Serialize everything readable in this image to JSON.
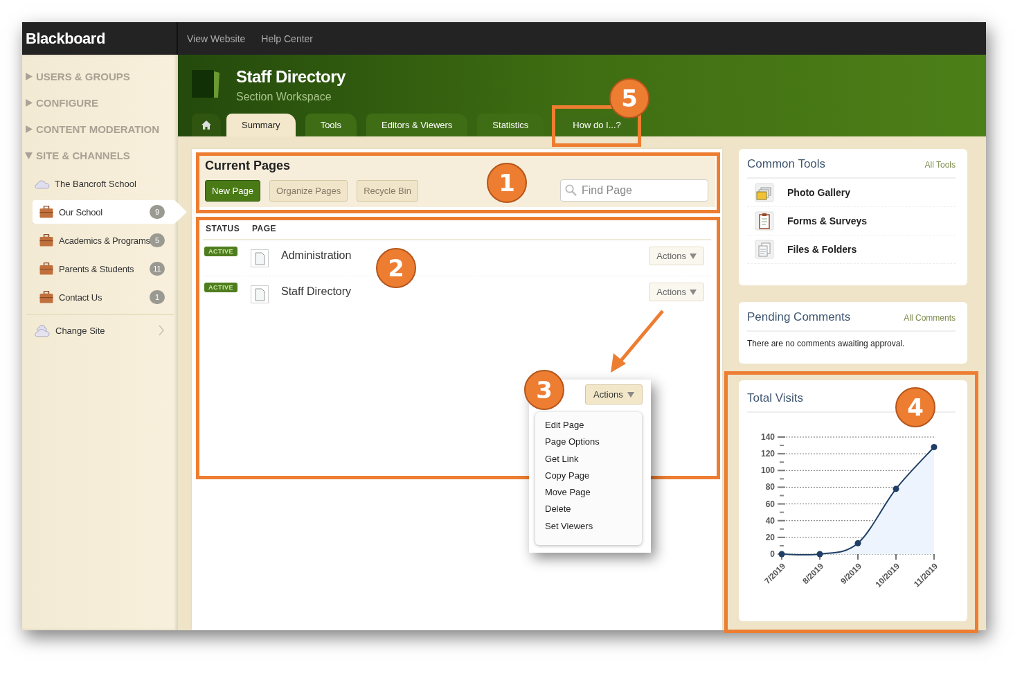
{
  "top_bar": {
    "logo": "Blackboard",
    "links": [
      "View Website",
      "Help Center"
    ]
  },
  "sidebar": {
    "sections": [
      {
        "label": "USERS & GROUPS",
        "expanded": false
      },
      {
        "label": "CONFIGURE",
        "expanded": false
      },
      {
        "label": "CONTENT MODERATION",
        "expanded": false
      },
      {
        "label": "SITE & CHANNELS",
        "expanded": true,
        "site": "The Bancroft School",
        "channels": [
          {
            "label": "Our School",
            "count": "9",
            "selected": true
          },
          {
            "label": "Academics & Programs",
            "count": "5",
            "selected": false
          },
          {
            "label": "Parents & Students",
            "count": "11",
            "selected": false
          },
          {
            "label": "Contact Us",
            "count": "1",
            "selected": false
          }
        ]
      }
    ],
    "change_site": "Change Site"
  },
  "header": {
    "title": "Staff Directory",
    "subtitle": "Section Workspace",
    "tabs": [
      {
        "kind": "home",
        "selected": false
      },
      {
        "kind": "text",
        "label": "Summary",
        "selected": true
      },
      {
        "kind": "text",
        "label": "Tools",
        "selected": false
      },
      {
        "kind": "text",
        "label": "Editors & Viewers",
        "selected": false
      },
      {
        "kind": "text",
        "label": "Statistics",
        "selected": false
      },
      {
        "kind": "text",
        "label": "How do I...?",
        "selected": false
      }
    ]
  },
  "current_pages": {
    "title": "Current Pages",
    "buttons": [
      {
        "label": "New Page",
        "kind": "primary"
      },
      {
        "label": "Organize Pages",
        "kind": "secondary"
      },
      {
        "label": "Recycle Bin",
        "kind": "secondary"
      }
    ],
    "search": {
      "placeholder": "Find Page"
    },
    "columns": [
      "STATUS",
      "PAGE"
    ],
    "rows": [
      {
        "status": "ACTIVE",
        "page": "Administration",
        "action": "Actions"
      },
      {
        "status": "ACTIVE",
        "page": "Staff Directory",
        "action": "Actions"
      }
    ]
  },
  "actions_menu": {
    "button": "Actions",
    "items": [
      "Edit Page",
      "Page Options",
      "Get Link",
      "Copy Page",
      "Move Page",
      "Delete",
      "Set Viewers"
    ]
  },
  "common_tools": {
    "title": "Common Tools",
    "link": "All Tools",
    "items": [
      {
        "label": "Photo Gallery",
        "kind": "photo"
      },
      {
        "label": "Forms & Surveys",
        "kind": "form"
      },
      {
        "label": "Files & Folders",
        "kind": "files"
      }
    ]
  },
  "pending_comments": {
    "title": "Pending Comments",
    "link": "All Comments",
    "message": "There are no comments awaiting approval."
  },
  "total_visits": {
    "title": "Total Visits",
    "chart_data": {
      "type": "area",
      "categories": [
        "7/2019",
        "8/2019",
        "9/2019",
        "10/2019",
        "11/2019"
      ],
      "series": [
        {
          "color": "#1f3f66",
          "values": [
            0,
            0,
            13,
            78,
            128
          ]
        }
      ],
      "grid": true,
      "ylim": [
        0,
        140
      ],
      "yticks": [
        0,
        20,
        40,
        60,
        80,
        100,
        120,
        140
      ]
    }
  },
  "callouts": [
    {
      "label": "1"
    },
    {
      "label": "2"
    },
    {
      "label": "3"
    },
    {
      "label": "4"
    },
    {
      "label": "5"
    }
  ]
}
